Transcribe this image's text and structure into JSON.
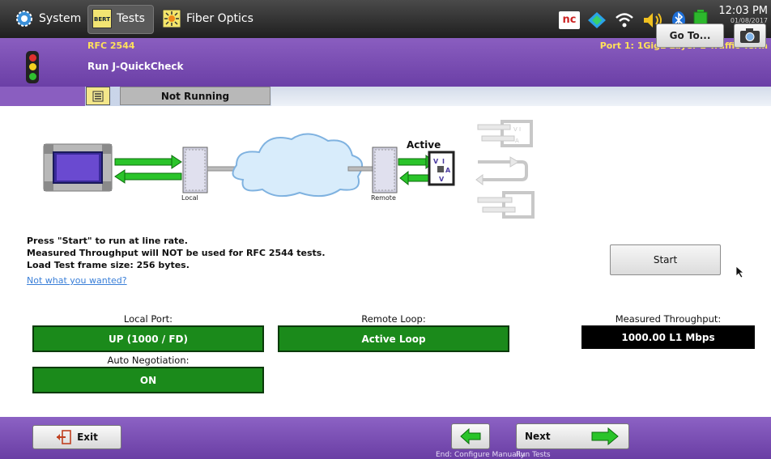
{
  "topbar": {
    "system_label": "System",
    "tests_label": "Tests",
    "fiber_label": "Fiber Optics",
    "tests_icon_text": "BERT",
    "time": "12:03 PM",
    "date": "01/08/2017",
    "status_icons": [
      "nc-icon",
      "network-icon",
      "wifi-icon",
      "speaker-icon",
      "bluetooth-icon",
      "battery-icon"
    ]
  },
  "header": {
    "test_name": "RFC 2544",
    "subtitle": "Run J-QuickCheck",
    "port": "Port 1: 1GigE Layer 2 Traffic Term",
    "goto_label": "Go To..."
  },
  "subbar": {
    "status": "Not Running"
  },
  "diagram": {
    "local_label": "Local",
    "remote_label": "Remote",
    "active_label": "Active",
    "loop_badge": [
      "V",
      "I",
      "A",
      "I",
      "V"
    ]
  },
  "messages": {
    "line1": "Press \"Start\" to run at line rate.",
    "line2": "Measured Throughput will NOT be used for RFC 2544 tests.",
    "line3": "Load Test frame size: 256 bytes.",
    "link": "Not what you wanted?"
  },
  "start_label": "Start",
  "fields": {
    "local_port_label": "Local Port:",
    "local_port_value": "UP (1000 / FD)",
    "remote_loop_label": "Remote Loop:",
    "remote_loop_value": "Active Loop",
    "throughput_label": "Measured Throughput:",
    "throughput_value": "1000.00 L1 Mbps",
    "autoneg_label": "Auto Negotiation:",
    "autoneg_value": "ON"
  },
  "bottombar": {
    "exit_label": "Exit",
    "next_label": "Next",
    "back_caption": "End: Configure Manually",
    "next_caption": "Run Tests"
  },
  "colors": {
    "purple": "#7a4fb3",
    "green": "#1b8a1b",
    "yellow": "#ffe15a"
  }
}
